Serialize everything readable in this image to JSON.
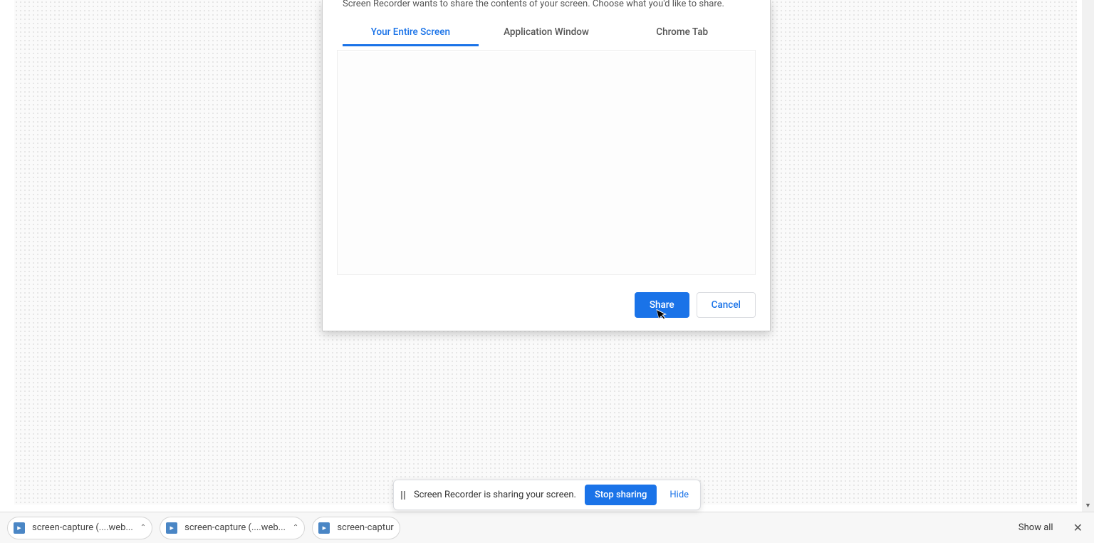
{
  "background": {
    "app_title": "Screen Recorder"
  },
  "dialog": {
    "subtitle": "Screen Recorder wants to share the contents of your screen. Choose what you'd like to share.",
    "tabs": {
      "entire_screen": "Your Entire Screen",
      "app_window": "Application Window",
      "chrome_tab": "Chrome Tab"
    },
    "buttons": {
      "share": "Share",
      "cancel": "Cancel"
    }
  },
  "downloads": {
    "items": [
      {
        "name": "screen-capture (....web..."
      },
      {
        "name": "screen-capture (....web..."
      },
      {
        "name": "screen-captur"
      }
    ],
    "show_all": "Show all"
  },
  "toast": {
    "text": "Screen Recorder is sharing your screen.",
    "stop": "Stop sharing",
    "hide": "Hide"
  }
}
